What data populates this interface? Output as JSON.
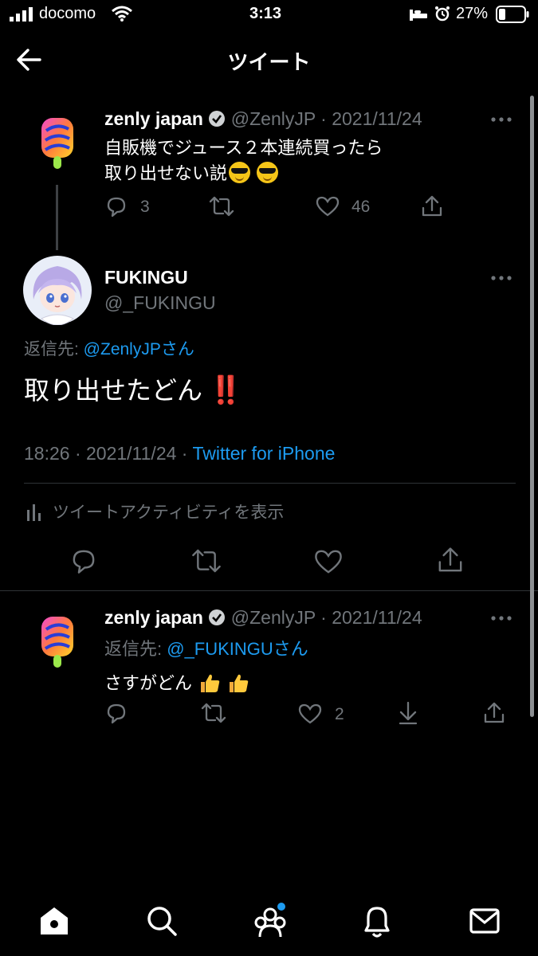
{
  "status_bar": {
    "carrier": "docomo",
    "time": "3:13",
    "battery": "27%"
  },
  "header": {
    "title": "ツイート"
  },
  "parent_tweet": {
    "author_name": "zenly japan",
    "handle": "@ZenlyJP",
    "date": "· 2021/11/24",
    "text_line1": "自販機でジュース２本連続買ったら",
    "text_line2": "取り出せない説",
    "reply_count": "3",
    "like_count": "46"
  },
  "main_tweet": {
    "author_name": "FUKINGU",
    "handle": "@_FUKINGU",
    "reply_to_prefix": "返信先: ",
    "reply_to_handle": "@ZenlyJPさん",
    "text": "取り出せたどん",
    "emoji_text": "‼️",
    "timestamp": "18:26 · 2021/11/24 ·",
    "source": "Twitter for iPhone",
    "activity_label": "ツイートアクティビティを表示"
  },
  "reply_tweet": {
    "author_name": "zenly japan",
    "handle": "@ZenlyJP",
    "date": "· 2021/11/24",
    "reply_to_prefix": "返信先: ",
    "reply_to_handle": "@_FUKINGUさん",
    "text": "さすがどん",
    "like_count": "2"
  },
  "colors": {
    "background": "#000000",
    "link": "#1d9bf0",
    "muted": "#71767b",
    "separator": "#2f3336"
  },
  "icons": {
    "nav": [
      "home-icon",
      "search-icon",
      "communities-icon",
      "notifications-icon",
      "messages-icon"
    ]
  }
}
